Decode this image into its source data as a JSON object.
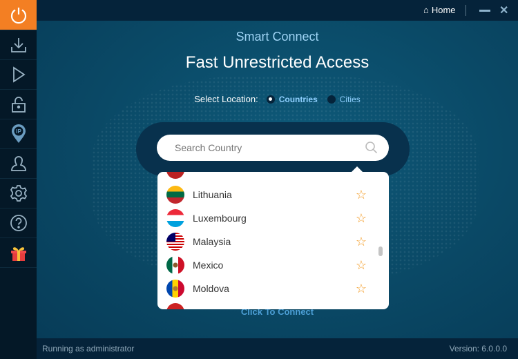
{
  "sidebar": {
    "items": [
      "power",
      "download",
      "play",
      "lock",
      "ip",
      "user",
      "settings",
      "help",
      "gift"
    ]
  },
  "topbar": {
    "home": "Home",
    "minimize": "—",
    "close": "✕"
  },
  "main": {
    "subtitle": "Smart Connect",
    "title": "Fast Unrestricted Access",
    "location_label": "Select Location:",
    "option_countries": "Countries",
    "option_cities": "Cities",
    "selected": "Countries",
    "connect": "Click To Connect"
  },
  "search": {
    "placeholder": "Search Country"
  },
  "countries": [
    {
      "name": "Lithuania",
      "favorite": false
    },
    {
      "name": "Luxembourg",
      "favorite": false
    },
    {
      "name": "Malaysia",
      "favorite": false
    },
    {
      "name": "Mexico",
      "favorite": false
    },
    {
      "name": "Moldova",
      "favorite": false
    }
  ],
  "status": {
    "left": "Running as administrator",
    "version": "Version:  6.0.0.0"
  },
  "colors": {
    "accent": "#f37f23",
    "star": "#f39a22",
    "link": "#8fd0ff"
  }
}
